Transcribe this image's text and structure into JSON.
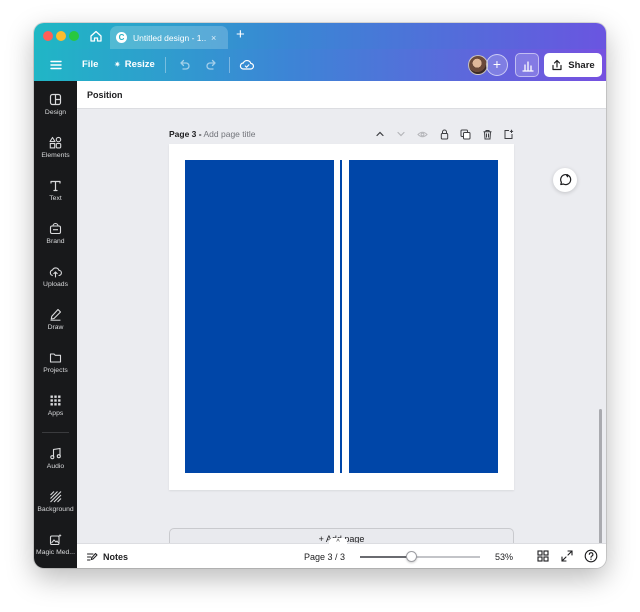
{
  "browser": {
    "home_icon": "home-icon",
    "tab_title": "Untitled design - 1...",
    "tab_favicon": "C",
    "tab_close": "×",
    "new_tab": "+"
  },
  "toolbar": {
    "file_label": "File",
    "resize_label": "Resize",
    "resize_icon": "✷",
    "add_collaborator": "+",
    "share_label": "Share",
    "gradient_start": "#1fb8c4",
    "gradient_end": "#7651e0"
  },
  "sidebar": {
    "items": [
      {
        "label": "Design",
        "icon": "design-icon"
      },
      {
        "label": "Elements",
        "icon": "elements-icon"
      },
      {
        "label": "Text",
        "icon": "text-icon"
      },
      {
        "label": "Brand",
        "icon": "brand-icon"
      },
      {
        "label": "Uploads",
        "icon": "uploads-icon"
      },
      {
        "label": "Draw",
        "icon": "draw-icon"
      },
      {
        "label": "Projects",
        "icon": "projects-icon"
      },
      {
        "label": "Apps",
        "icon": "apps-icon"
      },
      {
        "label": "Audio",
        "icon": "audio-icon"
      },
      {
        "label": "Background",
        "icon": "background-icon"
      },
      {
        "label": "Magic Med...",
        "icon": "magic-media-icon"
      }
    ]
  },
  "context_bar": {
    "position_label": "Position"
  },
  "page": {
    "number_label": "Page 3 -",
    "title_placeholder": "Add page title",
    "panel_color": "#0046a8",
    "add_page_label": "+ Add page"
  },
  "footer": {
    "handle": "^",
    "notes_label": "Notes",
    "page_count": "Page 3 / 3",
    "zoom_label": "53%",
    "zoom_level_percent": 53
  }
}
